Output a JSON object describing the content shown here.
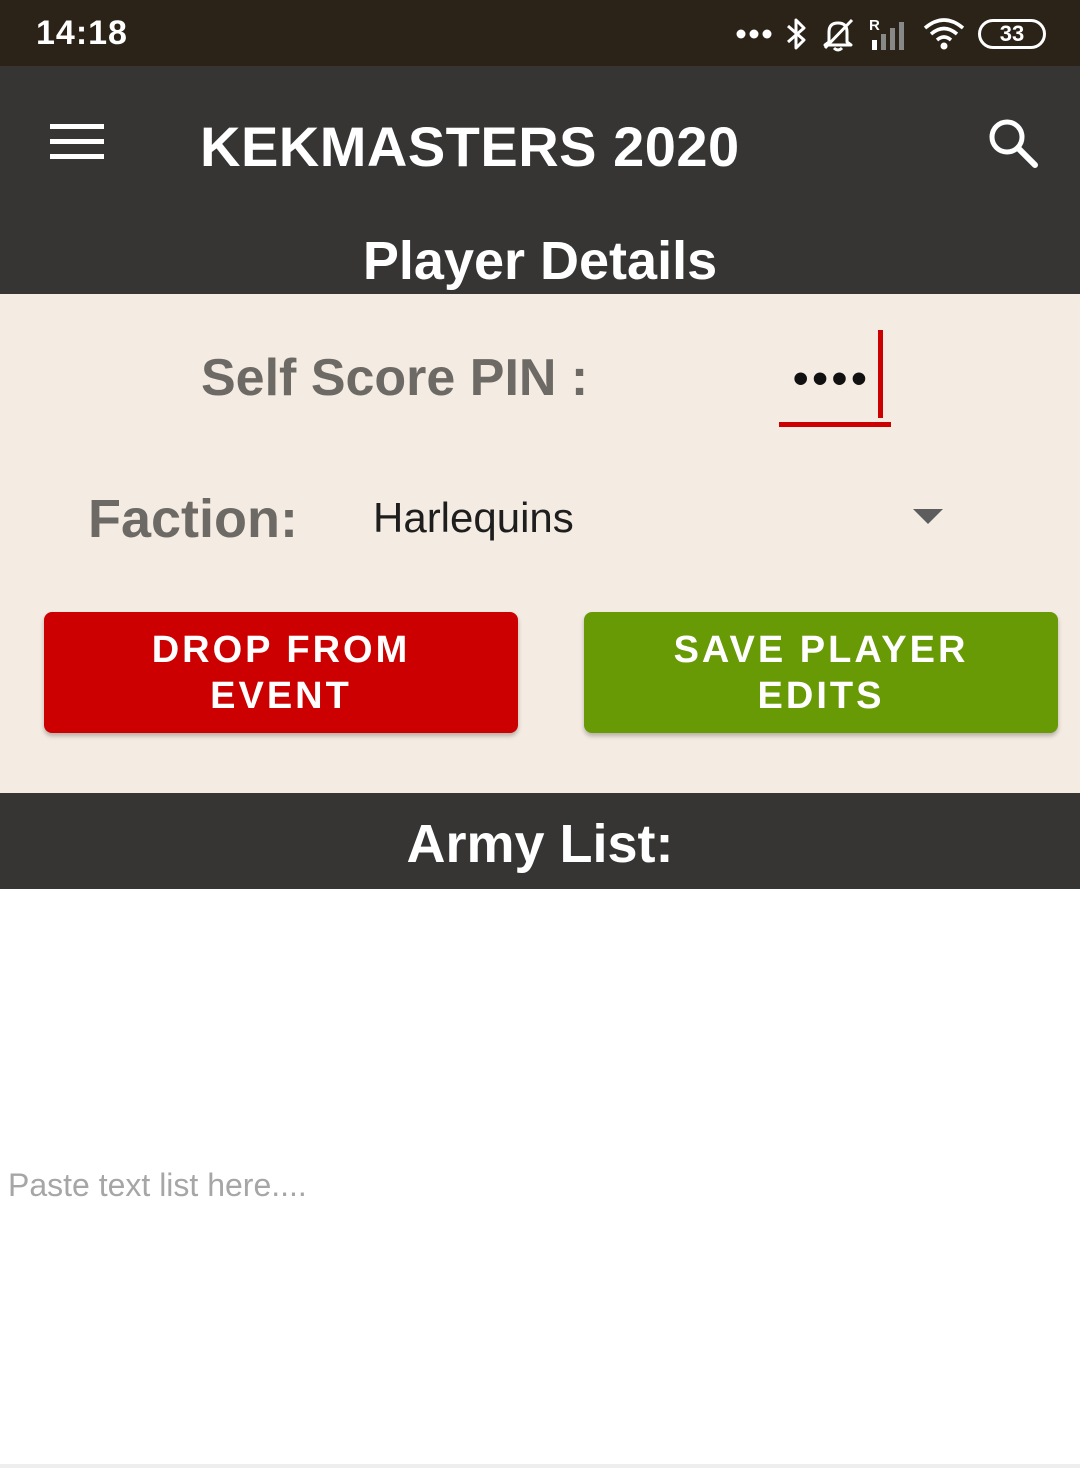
{
  "status_bar": {
    "time": "14:18",
    "battery": "33",
    "icons": [
      "more-dots-icon",
      "bluetooth-icon",
      "bell-off-icon",
      "signal-roaming-icon",
      "wifi-icon",
      "battery-icon"
    ]
  },
  "app_bar": {
    "title": "KEKMASTERS 2020",
    "menu_icon": "hamburger-menu-icon",
    "search_icon": "search-icon",
    "section_title": "Player Details"
  },
  "details": {
    "pin_label": "Self Score PIN :",
    "pin_value": "••••",
    "faction_label": "Faction:",
    "faction_value": "Harlequins",
    "drop_button": "DROP FROM EVENT",
    "save_button": "SAVE PLAYER EDITS"
  },
  "army_list": {
    "title": "Army List:",
    "placeholder": "Paste text list here...."
  },
  "colors": {
    "status_bar": "#2b2318",
    "app_bar": "#363534",
    "panel": "#f4ebe2",
    "drop": "#cc0000",
    "save": "#689a06",
    "accent": "#cc0000"
  }
}
